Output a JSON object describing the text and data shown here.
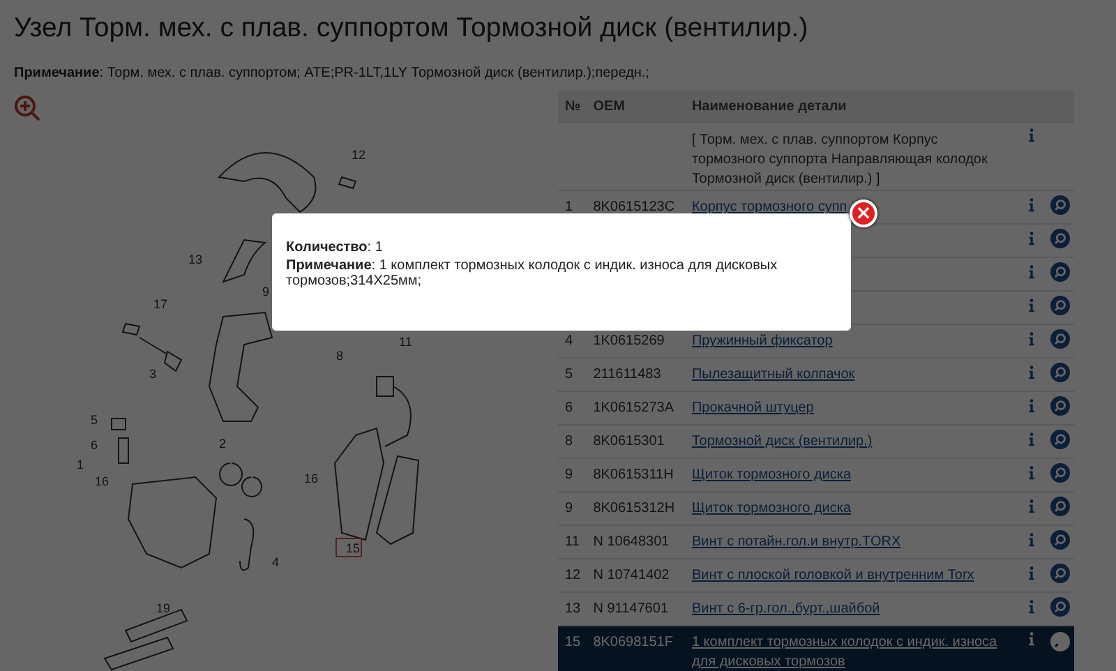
{
  "title": "Узел Торм. мех. с плав. суппортом Тормозной диск (вентилир.)",
  "note": "**Примечание**: Торм. мех. с плав. суппортом; ATE;PR-1LT,1LY Тормозной диск (вентилир.);передн.;",
  "diagram": {
    "callouts": [
      {
        "label": "12",
        "selected": false
      },
      {
        "label": "13",
        "selected": false
      },
      {
        "label": "9",
        "selected": false
      },
      {
        "label": "17",
        "selected": false
      },
      {
        "label": "11",
        "selected": false
      },
      {
        "label": "8",
        "selected": false
      },
      {
        "label": "3",
        "selected": false
      },
      {
        "label": "5",
        "selected": false
      },
      {
        "label": "2",
        "selected": false
      },
      {
        "label": "6",
        "selected": false
      },
      {
        "label": "1",
        "selected": false
      },
      {
        "label": "16",
        "selected": false
      },
      {
        "label": "16",
        "selected": false
      },
      {
        "label": "15",
        "selected": true
      },
      {
        "label": "4",
        "selected": false
      },
      {
        "label": "19",
        "selected": false
      }
    ]
  },
  "table": {
    "columns": [
      "№",
      "OEM",
      "Наименование детали"
    ],
    "rows": [
      {
        "kind": "group",
        "name": "[ Торм. мех. с плав. суппортом Корпус тормозного суппорта Направляющая колодок Тормозной диск (вентилир.) ]",
        "selected": false
      },
      {
        "kind": "part",
        "num": "1",
        "oem": "8K0615123C",
        "name": "Корпус тормозного супп",
        "selected": false
      },
      {
        "kind": "covered",
        "selected": false
      },
      {
        "kind": "covered",
        "selected": false
      },
      {
        "kind": "covered",
        "selected": false
      },
      {
        "kind": "part",
        "num": "4",
        "oem": "1K0615269",
        "name": "Пружинный фиксатор",
        "selected": false
      },
      {
        "kind": "part",
        "num": "5",
        "oem": "211611483",
        "name": "Пылезащитный колпачок",
        "selected": false
      },
      {
        "kind": "part",
        "num": "6",
        "oem": "1K0615273A",
        "name": "Прокачной штуцер",
        "selected": false
      },
      {
        "kind": "part",
        "num": "8",
        "oem": "8K0615301",
        "name": "Тормозной диск (вентилир.)",
        "selected": false
      },
      {
        "kind": "part",
        "num": "9",
        "oem": "8K0615311H",
        "name": "Щиток тормозного диска",
        "selected": false
      },
      {
        "kind": "part",
        "num": "9",
        "oem": "8K0615312H",
        "name": "Щиток тормозного диска",
        "selected": false
      },
      {
        "kind": "part",
        "num": "11",
        "oem": "N 10648301",
        "name": "Винт с потайн.гол.и внутр.TORX",
        "selected": false
      },
      {
        "kind": "part",
        "num": "12",
        "oem": "N 10741402",
        "name": "Винт с плоской головкой и внутренним Torx",
        "selected": false
      },
      {
        "kind": "part",
        "num": "13",
        "oem": "N 91147601",
        "name": "Винт с 6-гр.гол.,бурт.,шайбой",
        "selected": false
      },
      {
        "kind": "part",
        "num": "15",
        "oem": "8K0698151F",
        "name": "1 комплект тормозных колодок с индик. износа для дисковых тормозов",
        "selected": true
      }
    ]
  },
  "modal": {
    "lines": [
      "**Количество**: 1",
      "**Примечание**: 1 комплект тормозных колодок с индик. износа для дисковых тормозов;314X25мм;"
    ],
    "close": "×"
  }
}
